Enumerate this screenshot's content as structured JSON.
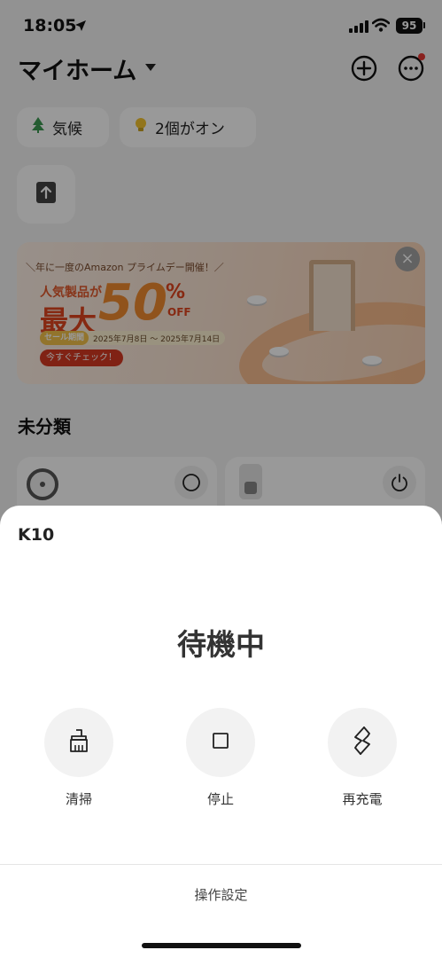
{
  "status_bar": {
    "time": "18:05",
    "battery": "95",
    "icons": [
      "location-arrow-icon",
      "signal-icon",
      "wifi-icon",
      "battery-icon"
    ]
  },
  "header": {
    "home_name": "マイホーム",
    "icons": [
      "chevron-down-icon",
      "add-circle-icon",
      "more-circle-icon"
    ]
  },
  "chips": [
    {
      "label": "気候",
      "icon": "tree-icon"
    },
    {
      "label": "2個がオン",
      "icon": "bulb-icon"
    }
  ],
  "banner": {
    "headline": "＼年に一度のAmazon プライムデー開催！／",
    "subline": "人気製品が",
    "main": "最大",
    "discount": "50",
    "percent": "%",
    "off": "OFF",
    "period_tag": "セール期間",
    "period": "2025年7月8日 〜 2025年7月14日",
    "cta": "今すぐチェック！",
    "close": "×"
  },
  "section": {
    "title": "未分類"
  },
  "sheet": {
    "device_name": "K10",
    "state": "待機中",
    "actions": [
      {
        "label": "清掃",
        "icon": "broom-icon"
      },
      {
        "label": "停止",
        "icon": "stop-icon"
      },
      {
        "label": "再充電",
        "icon": "recharge-icon"
      }
    ],
    "settings_label": "操作設定"
  }
}
